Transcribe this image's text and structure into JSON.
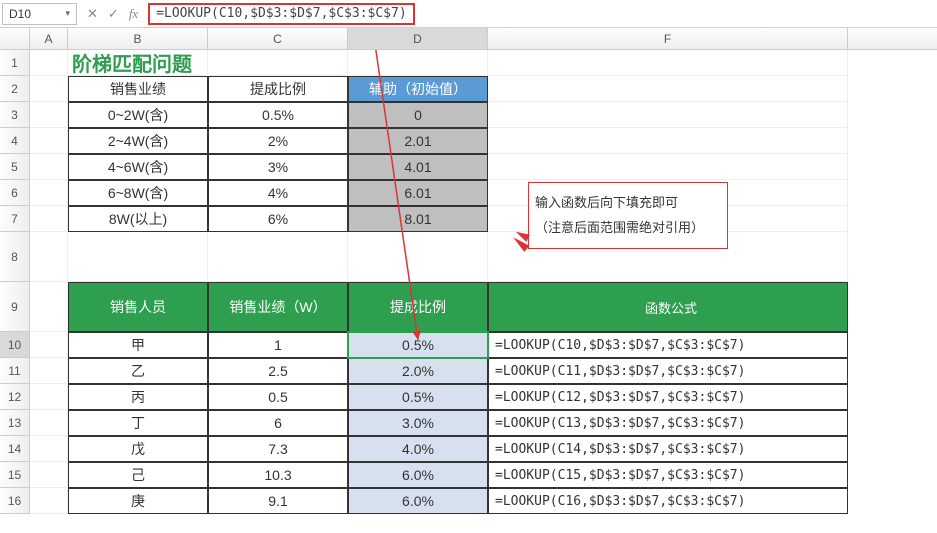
{
  "namebox": {
    "value": "D10",
    "chevron": "▾"
  },
  "fnbuttons": {
    "cancel": "✕",
    "enter": "✓",
    "fx": "fx"
  },
  "formula": "=LOOKUP(C10,$D$3:$D$7,$C$3:$C$7)",
  "columns": [
    "A",
    "B",
    "C",
    "D",
    "F"
  ],
  "rownums": [
    "1",
    "2",
    "3",
    "4",
    "5",
    "6",
    "7",
    "8",
    "9",
    "10",
    "11",
    "12",
    "13",
    "14",
    "15",
    "16"
  ],
  "title": "阶梯匹配问题",
  "table1": {
    "headers": [
      "销售业绩",
      "提成比例",
      "辅助（初始值）"
    ],
    "rows": [
      {
        "range": "0~2W(含)",
        "rate": "0.5%",
        "helper": "0"
      },
      {
        "range": "2~4W(含)",
        "rate": "2%",
        "helper": "2.01"
      },
      {
        "range": "4~6W(含)",
        "rate": "3%",
        "helper": "4.01"
      },
      {
        "range": "6~8W(含)",
        "rate": "4%",
        "helper": "6.01"
      },
      {
        "range": "8W(以上)",
        "rate": "6%",
        "helper": "8.01"
      }
    ]
  },
  "callout": {
    "line1": "输入函数后向下填充即可",
    "line2": "（注意后面范围需绝对引用）"
  },
  "table2": {
    "headers": [
      "销售人员",
      "销售业绩（W）",
      "提成比例",
      "函数公式"
    ],
    "rows": [
      {
        "name": "甲",
        "perf": "1",
        "rate": "0.5%",
        "formula": "=LOOKUP(C10,$D$3:$D$7,$C$3:$C$7)"
      },
      {
        "name": "乙",
        "perf": "2.5",
        "rate": "2.0%",
        "formula": "=LOOKUP(C11,$D$3:$D$7,$C$3:$C$7)"
      },
      {
        "name": "丙",
        "perf": "0.5",
        "rate": "0.5%",
        "formula": "=LOOKUP(C12,$D$3:$D$7,$C$3:$C$7)"
      },
      {
        "name": "丁",
        "perf": "6",
        "rate": "3.0%",
        "formula": "=LOOKUP(C13,$D$3:$D$7,$C$3:$C$7)"
      },
      {
        "name": "戊",
        "perf": "7.3",
        "rate": "4.0%",
        "formula": "=LOOKUP(C14,$D$3:$D$7,$C$3:$C$7)"
      },
      {
        "name": "己",
        "perf": "10.3",
        "rate": "6.0%",
        "formula": "=LOOKUP(C15,$D$3:$D$7,$C$3:$C$7)"
      },
      {
        "name": "庚",
        "perf": "9.1",
        "rate": "6.0%",
        "formula": "=LOOKUP(C16,$D$3:$D$7,$C$3:$C$7)"
      }
    ]
  },
  "chart_data": {
    "type": "table",
    "note": "Spreadsheet content (not a plotted chart)",
    "tiers": [
      {
        "bracket": "0~2W(含)",
        "rate_pct": 0.5,
        "helper": 0
      },
      {
        "bracket": "2~4W(含)",
        "rate_pct": 2,
        "helper": 2.01
      },
      {
        "bracket": "4~6W(含)",
        "rate_pct": 3,
        "helper": 4.01
      },
      {
        "bracket": "6~8W(含)",
        "rate_pct": 4,
        "helper": 6.01
      },
      {
        "bracket": "8W(以上)",
        "rate_pct": 6,
        "helper": 8.01
      }
    ],
    "sales": [
      {
        "person": "甲",
        "amount_w": 1,
        "rate_pct": 0.5
      },
      {
        "person": "乙",
        "amount_w": 2.5,
        "rate_pct": 2.0
      },
      {
        "person": "丙",
        "amount_w": 0.5,
        "rate_pct": 0.5
      },
      {
        "person": "丁",
        "amount_w": 6,
        "rate_pct": 3.0
      },
      {
        "person": "戊",
        "amount_w": 7.3,
        "rate_pct": 4.0
      },
      {
        "person": "己",
        "amount_w": 10.3,
        "rate_pct": 6.0
      },
      {
        "person": "庚",
        "amount_w": 9.1,
        "rate_pct": 6.0
      }
    ]
  }
}
